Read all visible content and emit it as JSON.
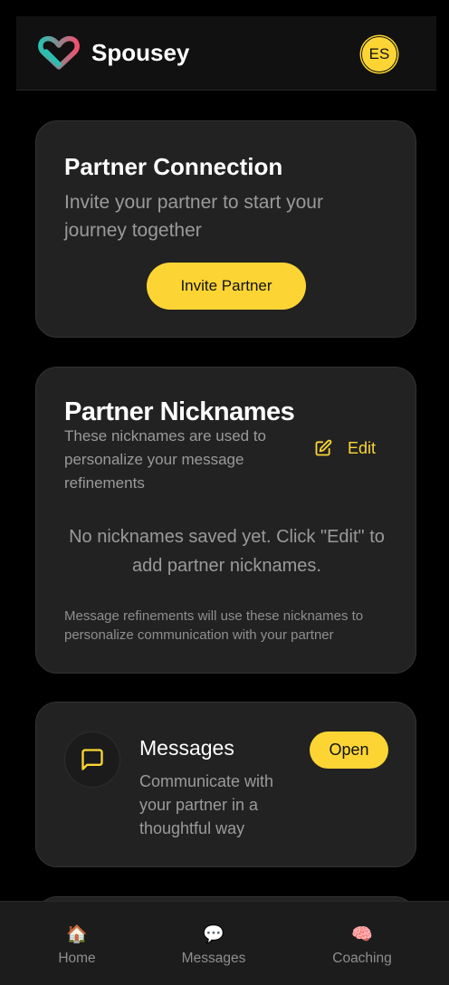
{
  "app": {
    "title": "Spousey",
    "avatar_initials": "ES",
    "accent_color": "#fcd535",
    "logo_colors": [
      "#2bbfb0",
      "#f0506e"
    ]
  },
  "connection_card": {
    "title": "Partner Connection",
    "subtitle": "Invite your partner to start your journey together",
    "invite_button": "Invite Partner"
  },
  "nicknames_card": {
    "title": "Partner Nicknames",
    "subtitle": "These nicknames are used to personalize your message refinements",
    "edit_button": "Edit",
    "empty_message": "No nicknames saved yet. Click \"Edit\" to add partner nicknames.",
    "footnote": "Message refinements will use these nicknames to personalize communication with your partner"
  },
  "messages_card": {
    "title": "Messages",
    "description": "Communicate with your partner in a thoughtful way",
    "open_button": "Open",
    "icon": "message-square-icon"
  },
  "bottom_nav": {
    "items": [
      {
        "label": "Home",
        "icon": "🏠",
        "icon_name": "house-icon"
      },
      {
        "label": "Messages",
        "icon": "💬",
        "icon_name": "speech-bubble-icon"
      },
      {
        "label": "Coaching",
        "icon": "🧠",
        "icon_name": "brain-icon"
      }
    ]
  }
}
